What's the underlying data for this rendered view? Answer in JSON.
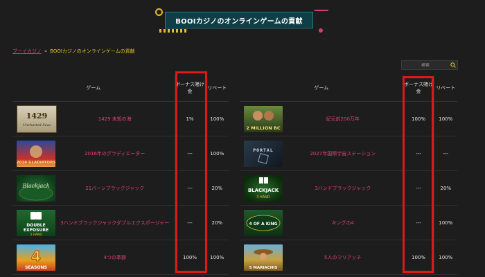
{
  "banner": {
    "title": "BOOIカジノのオンラインゲームの貢献"
  },
  "breadcrumb": {
    "home": "ブーイカジノ",
    "separator": "»",
    "current": "BOOIカジノのオンラインゲームの貢献"
  },
  "search": {
    "placeholder": "検索",
    "icon": "search-icon"
  },
  "table_headers": {
    "game": "ゲーム",
    "bonus": "ボーナス賭け金",
    "rebate": "リベート"
  },
  "left_table": {
    "rows": [
      {
        "thumb": "1429",
        "name": "1429 未知の海",
        "bonus": "1%",
        "rebate": "100%"
      },
      {
        "thumb": "glad",
        "name": "2016年のグラディエーター",
        "bonus": "---",
        "rebate": "100%"
      },
      {
        "thumb": "bj21",
        "name": "21バーンブラックジャック",
        "bonus": "---",
        "rebate": "20%"
      },
      {
        "thumb": "double",
        "name": "3ハンドブラックジャックダブルエクスポージャー",
        "bonus": "---",
        "rebate": "20%"
      },
      {
        "thumb": "seasons",
        "name": "4つの季節",
        "bonus": "100%",
        "rebate": "100%"
      }
    ]
  },
  "right_table": {
    "rows": [
      {
        "thumb": "2million",
        "name": "紀元前200万年",
        "bonus": "100%",
        "rebate": "100%"
      },
      {
        "thumb": "portal",
        "name": "2027年国際宇宙ステーション",
        "bonus": "---",
        "rebate": "---"
      },
      {
        "thumb": "bj3",
        "name": "3ハンドブラックジャック",
        "bonus": "---",
        "rebate": "20%"
      },
      {
        "thumb": "king",
        "name": "キングの4",
        "bonus": "---",
        "rebate": "100%"
      },
      {
        "thumb": "mari",
        "name": "5人のマリアッチ",
        "bonus": "100%",
        "rebate": "100%"
      }
    ]
  },
  "thumb_text": {
    "1429": "1429 Uncharted Seas",
    "glad": "2016 GLADIATORS",
    "bj21": "Blackjack",
    "double": "DOUBLE EXPOSURE 3 HAND",
    "seasons": "4 SEASONS",
    "2million": "2 MILLION BC",
    "portal": "PORTAL",
    "bj3": "BLACKJACK 3 HAND",
    "king": "4 OF A KING",
    "mari": "5 MARIACHIS"
  },
  "colors": {
    "background": "#1d1d1d",
    "accent_pink": "#e0407a",
    "accent_yellow": "#e0c02a",
    "banner_teal": "#0f3e47",
    "highlight_red": "#e01818"
  }
}
